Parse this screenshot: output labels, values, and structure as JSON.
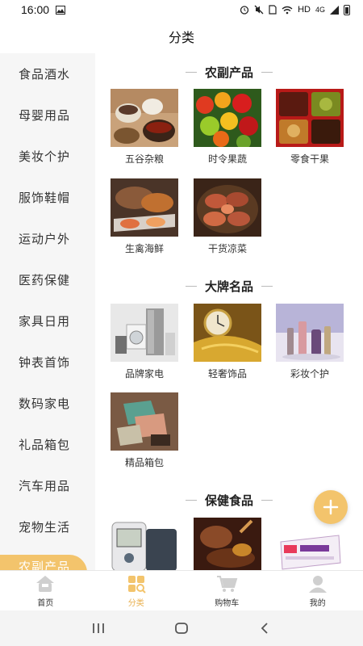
{
  "status_bar": {
    "time": "16:00",
    "network": "HD",
    "signal": "4G"
  },
  "header": {
    "title": "分类"
  },
  "sidebar": {
    "items": [
      {
        "label": "食品酒水"
      },
      {
        "label": "母婴用品"
      },
      {
        "label": "美妆个护"
      },
      {
        "label": "服饰鞋帽"
      },
      {
        "label": "运动户外"
      },
      {
        "label": "医药保健"
      },
      {
        "label": "家具日用"
      },
      {
        "label": "钟表首饰"
      },
      {
        "label": "数码家电"
      },
      {
        "label": "礼品箱包"
      },
      {
        "label": "汽车用品"
      },
      {
        "label": "宠物生活"
      },
      {
        "label": "农副产品"
      }
    ]
  },
  "sections": [
    {
      "title": "农副产品",
      "products": [
        {
          "label": "五谷杂粮"
        },
        {
          "label": "时令果蔬"
        },
        {
          "label": "零食干果"
        },
        {
          "label": "生禽海鲜"
        },
        {
          "label": "干货凉菜"
        }
      ]
    },
    {
      "title": "大牌名品",
      "products": [
        {
          "label": "品牌家电"
        },
        {
          "label": "轻奢饰品"
        },
        {
          "label": "彩妆个护"
        },
        {
          "label": "精品箱包"
        }
      ]
    },
    {
      "title": "保健食品",
      "products": [
        {
          "label": ""
        },
        {
          "label": ""
        },
        {
          "label": ""
        }
      ]
    }
  ],
  "tabbar": {
    "tabs": [
      {
        "label": "首页",
        "icon": "home-icon"
      },
      {
        "label": "分类",
        "icon": "category-icon"
      },
      {
        "label": "购物车",
        "icon": "cart-icon"
      },
      {
        "label": "我的",
        "icon": "user-icon"
      }
    ]
  },
  "colors": {
    "accent": "#f3c46c",
    "active_tab": "#e9b04f"
  }
}
